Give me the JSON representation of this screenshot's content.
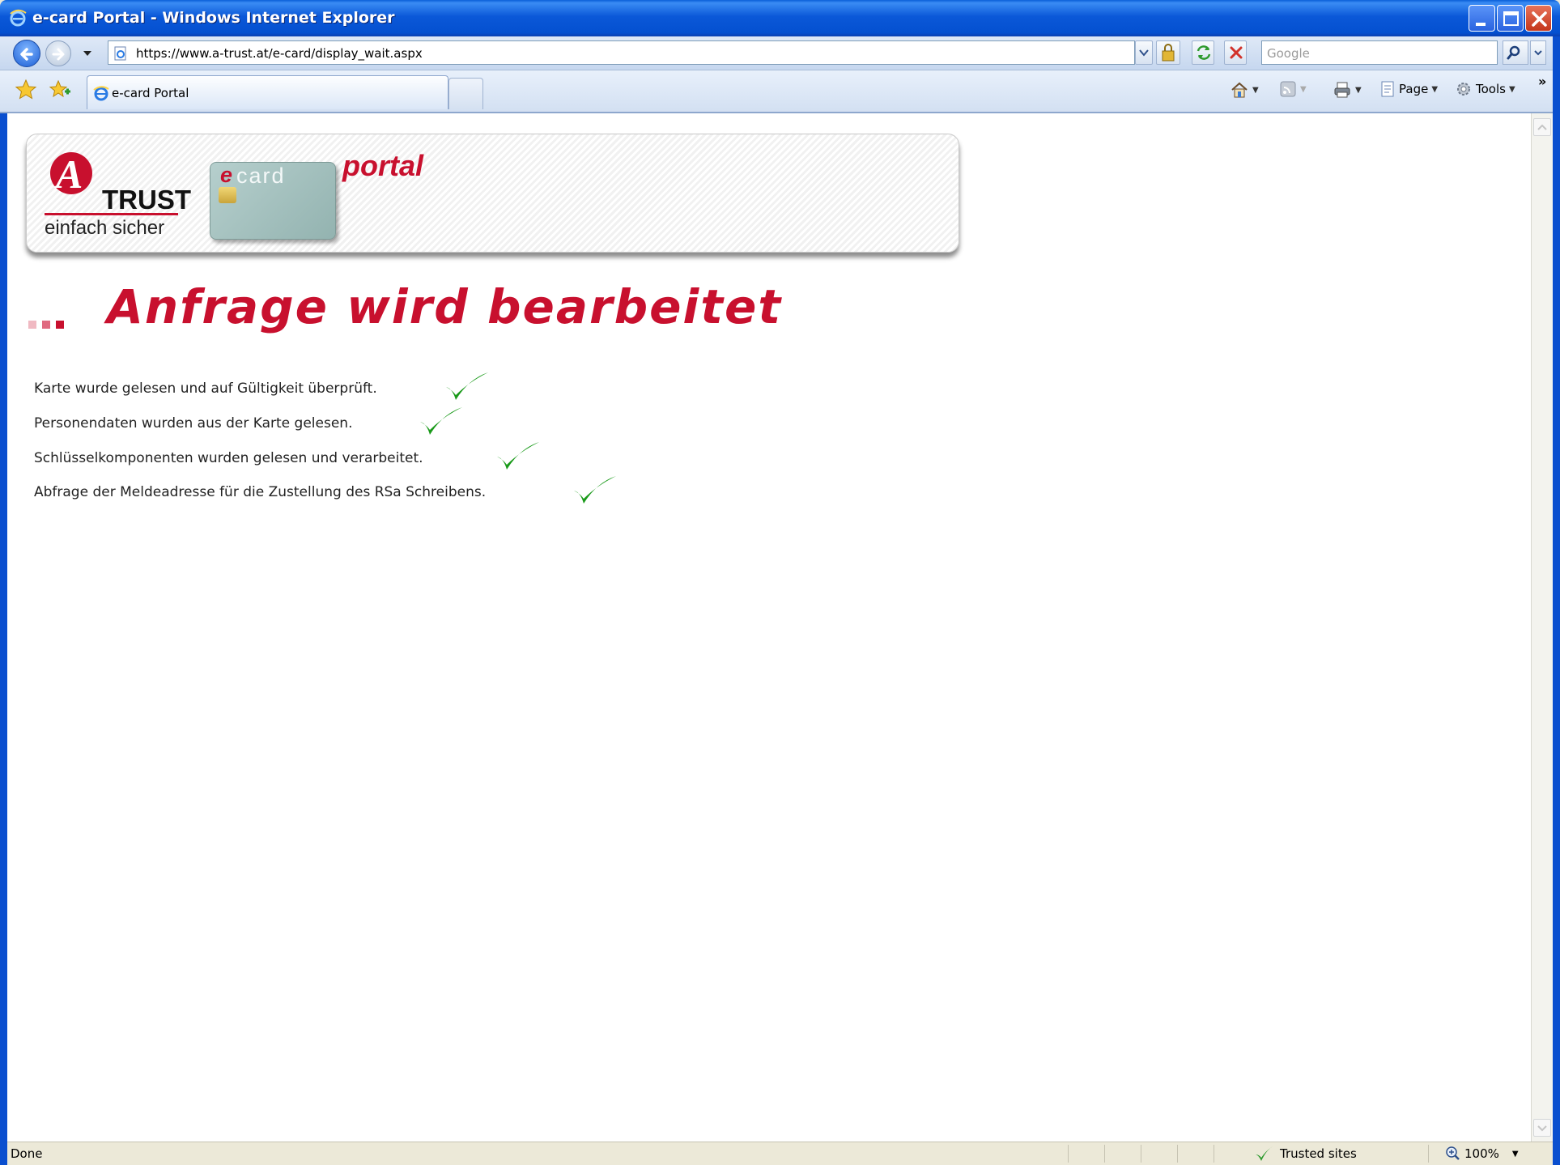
{
  "window": {
    "title": "e-card Portal - Windows Internet Explorer"
  },
  "address_bar": {
    "url": "https://www.a-trust.at/e-card/display_wait.aspx",
    "search_placeholder": "Google"
  },
  "tabs": [
    {
      "label": "e-card Portal",
      "active": true
    }
  ],
  "command_bar": {
    "page_label": "Page",
    "tools_label": "Tools"
  },
  "banner": {
    "logo_letter": "A",
    "logo_word": "TRUST",
    "tagline": "einfach sicher",
    "ecard_prefix": "e",
    "ecard_suffix": "card",
    "portal_label": "portal"
  },
  "page": {
    "heading": "Anfrage wird bearbeitet",
    "status_lines": [
      {
        "text": "Karte wurde gelesen und auf Gültigkeit überprüft.",
        "done": true
      },
      {
        "text": "Personendaten wurden aus der Karte gelesen.",
        "done": true
      },
      {
        "text": "Schlüsselkomponenten wurden gelesen und verarbeitet.",
        "done": true
      },
      {
        "text": "Abfrage der Meldeadresse für die Zustellung des RSa Schreibens.",
        "done": true
      }
    ]
  },
  "status_bar": {
    "status": "Done",
    "zone": "Trusted sites",
    "zoom": "100%"
  },
  "colors": {
    "brand_red": "#c8102e",
    "check_green": "#1a9a1a",
    "titlebar_blue": "#0b58d8"
  },
  "icons": {
    "back": "back-arrow-icon",
    "forward": "forward-arrow-icon",
    "lock": "lock-icon",
    "refresh": "refresh-icon",
    "stop": "stop-icon",
    "search": "search-icon",
    "favorites": "favorites-star-icon",
    "add_favorites": "add-favorites-icon",
    "home": "home-icon",
    "feeds": "feeds-icon",
    "print": "printer-icon",
    "page": "page-icon",
    "tools": "gear-icon",
    "check": "checkmark-icon",
    "zoom": "zoom-icon"
  }
}
